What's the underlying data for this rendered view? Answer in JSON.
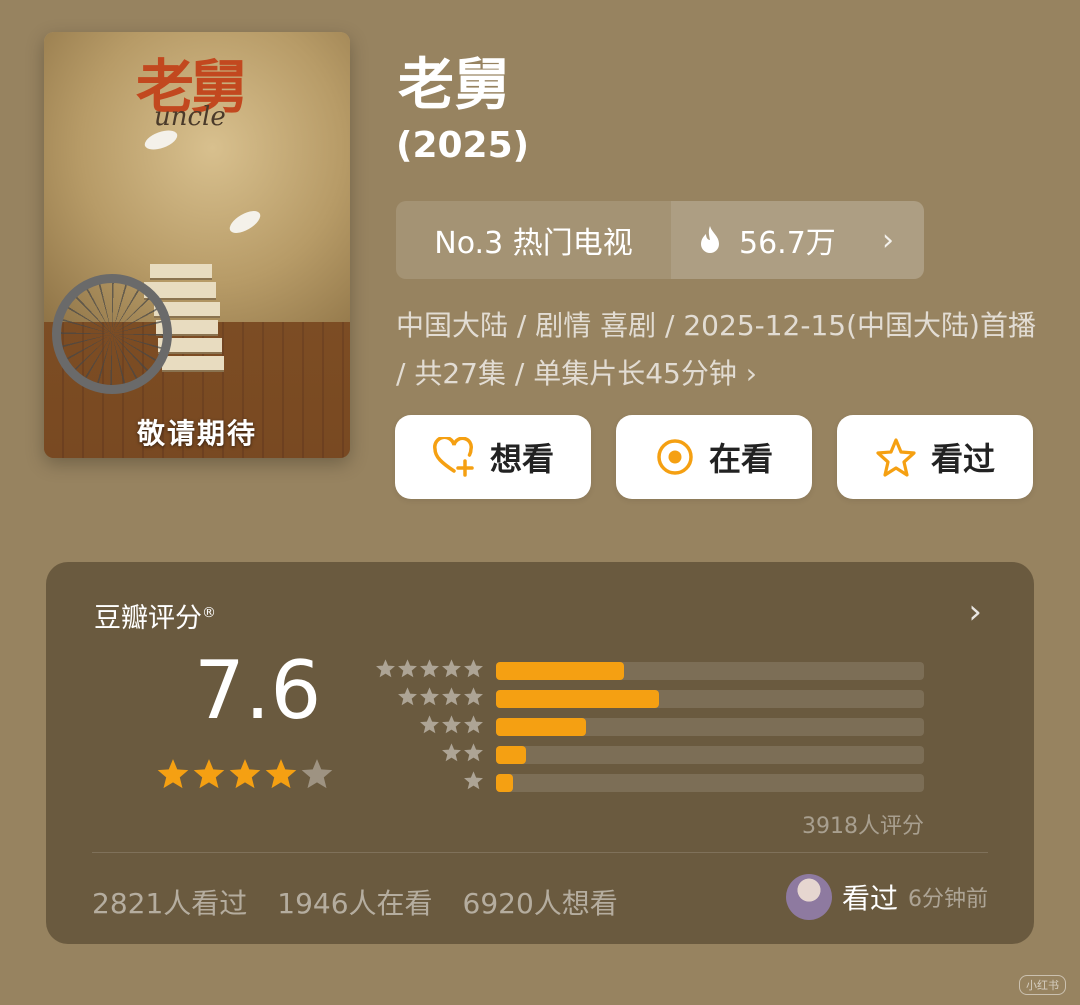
{
  "poster": {
    "title_art": "老舅",
    "subtitle_art": "uncle",
    "caption": "敬请期待"
  },
  "header": {
    "title": "老舅",
    "year": "(2025)"
  },
  "ranking": {
    "rank_label": "No.3 热门电视",
    "heat_icon": "flame-icon",
    "heat_value": "56.7万"
  },
  "meta": {
    "line": "中国大陆 / 剧情 喜剧 / 2025-12-15(中国大陆)首播 / 共27集 / 单集片长45分钟"
  },
  "actions": [
    {
      "label": "想看",
      "icon": "heart-plus-icon"
    },
    {
      "label": "在看",
      "icon": "target-icon"
    },
    {
      "label": "看过",
      "icon": "star-outline-icon"
    }
  ],
  "rating": {
    "title": "豆瓣评分",
    "registered": "®",
    "score": "7.6",
    "score_stars": 3.8,
    "distribution": [
      {
        "stars": 5,
        "fraction": 0.3
      },
      {
        "stars": 4,
        "fraction": 0.38
      },
      {
        "stars": 3,
        "fraction": 0.21
      },
      {
        "stars": 2,
        "fraction": 0.07
      },
      {
        "stars": 1,
        "fraction": 0.04
      }
    ],
    "total": "3918人评分"
  },
  "stats": {
    "watched": "2821人看过",
    "watching": "1946人在看",
    "want": "6920人想看"
  },
  "friend": {
    "status": "看过",
    "time": "6分钟前"
  },
  "watermark": "小红书",
  "colors": {
    "background": "#978360",
    "card": "#6a5a3f",
    "accent": "#f5a012"
  }
}
